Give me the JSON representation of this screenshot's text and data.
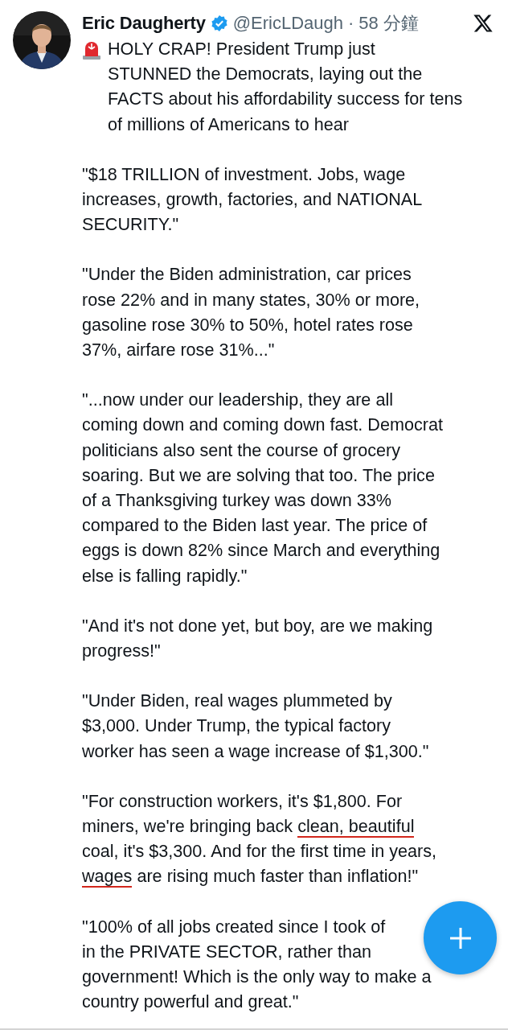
{
  "tweet": {
    "author": {
      "name": "Eric Daugherty",
      "verified": true,
      "handle": "@EricLDaugh",
      "separator": "·",
      "time": "58 分鐘"
    },
    "paragraphs": [
      {
        "siren": true,
        "lines": [
          "HOLY CRAP! President Trump just",
          "STUNNED the Democrats, laying out the",
          "FACTS about his affordability success for tens",
          "of millions of Americans to hear"
        ]
      },
      {
        "lines": [
          "\"$18 TRILLION of investment. Jobs, wage",
          "increases, growth, factories, and NATIONAL",
          "SECURITY.\""
        ]
      },
      {
        "lines": [
          "\"Under the Biden administration, car prices",
          "rose 22% and in many states, 30% or more,",
          "gasoline rose 30% to 50%, hotel rates rose",
          "37%, airfare rose 31%...\""
        ]
      },
      {
        "lines": [
          "\"...now under our leadership, they are all",
          "coming down and coming down fast. Democrat",
          "politicians also sent the course of grocery",
          "soaring. But we are solving that too. The price",
          "of a Thanksgiving turkey was down 33%",
          "compared to the Biden last year. The price of",
          "eggs is down 82% since March and everything",
          "else is falling rapidly.\""
        ]
      },
      {
        "lines": [
          "\"And it's not done yet, but boy, are we making",
          "progress!\""
        ]
      },
      {
        "lines": [
          "\"Under Biden, real wages plummeted by",
          "$3,000. Under Trump, the typical factory",
          "worker has seen a wage increase of $1,300.\""
        ]
      },
      {
        "lines": [
          "\"For construction workers, it's $1,800. For",
          [
            {
              "text": "miners, we're bringing back ",
              "underlined": false
            },
            {
              "text": "clean, beautiful",
              "underlined": true
            }
          ],
          "coal, it's $3,300. And for the first time in years,",
          [
            {
              "text": "wages",
              "underlined": true
            },
            {
              "text": " are rising much faster than inflation!\"",
              "underlined": false
            }
          ]
        ]
      },
      {
        "lines": [
          "\"100% of all jobs created since I took of",
          "in the PRIVATE SECTOR, rather than",
          "government! Which is the only way to make a",
          "country powerful and great.\""
        ]
      }
    ]
  }
}
